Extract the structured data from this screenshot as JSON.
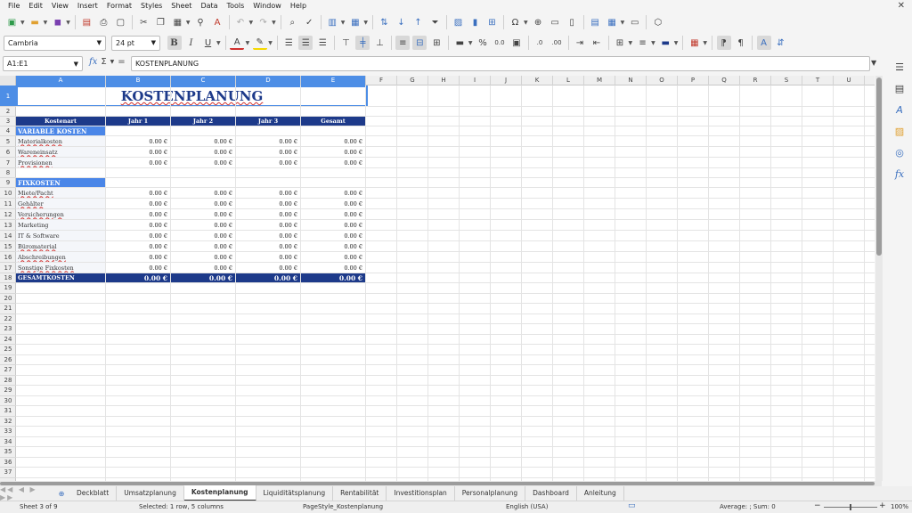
{
  "menu": {
    "items": [
      "File",
      "Edit",
      "View",
      "Insert",
      "Format",
      "Styles",
      "Sheet",
      "Data",
      "Tools",
      "Window",
      "Help"
    ]
  },
  "toolbar": {
    "font_name": "Cambria",
    "font_size": "24 pt",
    "bold": "B",
    "italic": "I",
    "underline": "U",
    "percent": "%",
    "decimal": "0.0",
    "para_mark": "¶"
  },
  "formula": {
    "name_box": "A1:E1",
    "sum_icon": "Σ",
    "equals": "=",
    "content": "KOSTENPLANUNG"
  },
  "columns": [
    "A",
    "B",
    "C",
    "D",
    "E",
    "F",
    "G",
    "H",
    "I",
    "J",
    "K",
    "L",
    "M",
    "N",
    "O",
    "P",
    "Q",
    "R",
    "S",
    "T",
    "U"
  ],
  "rows": [
    "1",
    "2",
    "3",
    "4",
    "5",
    "6",
    "7",
    "8",
    "9",
    "10",
    "11",
    "12",
    "13",
    "14",
    "15",
    "16",
    "17",
    "18",
    "19",
    "20",
    "21",
    "22",
    "23",
    "24",
    "25",
    "26",
    "27",
    "28",
    "29",
    "30",
    "31",
    "32",
    "33",
    "34",
    "35",
    "36",
    "37"
  ],
  "sheet": {
    "title": "KOSTENPLANUNG",
    "headers": [
      "Kostenart",
      "Jahr 1",
      "Jahr 2",
      "Jahr 3",
      "Gesamt"
    ],
    "variable_section": "VARIABLE KOSTEN",
    "variable_rows": [
      {
        "label": "Materialkosten",
        "values": [
          "0.00 €",
          "0.00 €",
          "0.00 €",
          "0.00 €"
        ]
      },
      {
        "label": "Wareneinsatz",
        "values": [
          "0.00 €",
          "0.00 €",
          "0.00 €",
          "0.00 €"
        ]
      },
      {
        "label": "Provisionen",
        "values": [
          "0.00 €",
          "0.00 €",
          "0.00 €",
          "0.00 €"
        ]
      }
    ],
    "fixed_section": "FIXKOSTEN",
    "fixed_rows": [
      {
        "label": "Miete/Pacht",
        "values": [
          "0.00 €",
          "0.00 €",
          "0.00 €",
          "0.00 €"
        ]
      },
      {
        "label": "Gehälter",
        "values": [
          "0.00 €",
          "0.00 €",
          "0.00 €",
          "0.00 €"
        ]
      },
      {
        "label": "Versicherungen",
        "values": [
          "0.00 €",
          "0.00 €",
          "0.00 €",
          "0.00 €"
        ]
      },
      {
        "label": "Marketing",
        "values": [
          "0.00 €",
          "0.00 €",
          "0.00 €",
          "0.00 €"
        ]
      },
      {
        "label": "IT & Software",
        "values": [
          "0.00 €",
          "0.00 €",
          "0.00 €",
          "0.00 €"
        ]
      },
      {
        "label": "Büromaterial",
        "values": [
          "0.00 €",
          "0.00 €",
          "0.00 €",
          "0.00 €"
        ]
      },
      {
        "label": "Abschreibungen",
        "values": [
          "0.00 €",
          "0.00 €",
          "0.00 €",
          "0.00 €"
        ]
      },
      {
        "label": "Sonstige Fixkosten",
        "values": [
          "0.00 €",
          "0.00 €",
          "0.00 €",
          "0.00 €"
        ]
      }
    ],
    "total_label": "GESAMTKOSTEN",
    "total_values": [
      "0.00 €",
      "0.00 €",
      "0.00 €",
      "0.00 €"
    ]
  },
  "tabs": {
    "add": "⊕",
    "items": [
      "Deckblatt",
      "Umsatzplanung",
      "Kostenplanung",
      "Liquiditätsplanung",
      "Rentabilität",
      "Investitionsplan",
      "Personalplanung",
      "Dashboard",
      "Anleitung"
    ],
    "active": "Kostenplanung"
  },
  "status": {
    "sheet": "Sheet 3 of 9",
    "selection": "Selected: 1 row, 5 columns",
    "page_style": "PageStyle_Kostenplanung",
    "language": "English (USA)",
    "summary": "Average: ; Sum: 0",
    "zoom_minus": "−",
    "zoom_plus": "+",
    "zoom": "100%"
  },
  "colors": {
    "navy": "#1d3a8a",
    "section_blue": "#4a86e8",
    "selection_blue": "#4d8ee6"
  }
}
